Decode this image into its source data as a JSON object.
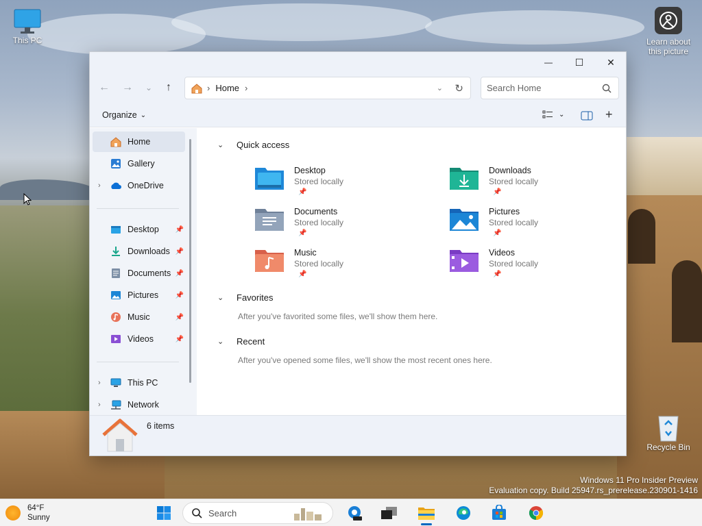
{
  "desktop": {
    "icons": {
      "this_pc": "This PC",
      "learn_picture": "Learn about this picture",
      "recycle_bin": "Recycle Bin"
    },
    "watermark": {
      "line1": "Windows 11 Pro Insider Preview",
      "line2": "Evaluation copy. Build 25947.rs_prerelease.230901-1416"
    }
  },
  "window": {
    "controls": {
      "minimize": "—",
      "maximize": "☐",
      "close": "✕"
    },
    "nav": {
      "back": "←",
      "forward": "→",
      "recent": "⌄",
      "up": "↑"
    },
    "address": {
      "location": "Home",
      "separator": "›"
    },
    "search": {
      "placeholder": "Search Home"
    },
    "command_bar": {
      "organize": "Organize"
    },
    "sidebar": {
      "items": [
        {
          "label": "Home",
          "icon": "home-icon"
        },
        {
          "label": "Gallery",
          "icon": "gallery-icon"
        },
        {
          "label": "OneDrive",
          "icon": "onedrive-icon"
        },
        {
          "label": "Desktop",
          "icon": "desktop-icon"
        },
        {
          "label": "Downloads",
          "icon": "downloads-icon"
        },
        {
          "label": "Documents",
          "icon": "documents-icon"
        },
        {
          "label": "Pictures",
          "icon": "pictures-icon"
        },
        {
          "label": "Music",
          "icon": "music-icon"
        },
        {
          "label": "Videos",
          "icon": "videos-icon"
        },
        {
          "label": "This PC",
          "icon": "this-pc-icon"
        },
        {
          "label": "Network",
          "icon": "network-icon"
        }
      ]
    },
    "content": {
      "quick_access": {
        "title": "Quick access",
        "items": [
          {
            "name": "Desktop",
            "sub": "Stored locally",
            "color": "#1e88d8"
          },
          {
            "name": "Downloads",
            "sub": "Stored locally",
            "color": "#1aa68c"
          },
          {
            "name": "Documents",
            "sub": "Stored locally",
            "color": "#7d8fa6"
          },
          {
            "name": "Pictures",
            "sub": "Stored locally",
            "color": "#1c86d6"
          },
          {
            "name": "Music",
            "sub": "Stored locally",
            "color": "#e8735a"
          },
          {
            "name": "Videos",
            "sub": "Stored locally",
            "color": "#8a4fd4"
          }
        ]
      },
      "favorites": {
        "title": "Favorites",
        "message": "After you've favorited some files, we'll show them here."
      },
      "recent": {
        "title": "Recent",
        "message": "After you've opened some files, we'll show the most recent ones here."
      }
    },
    "status": {
      "count": "6 items"
    }
  },
  "taskbar": {
    "weather": {
      "temp": "64°F",
      "condition": "Sunny"
    },
    "search_placeholder": "Search"
  }
}
